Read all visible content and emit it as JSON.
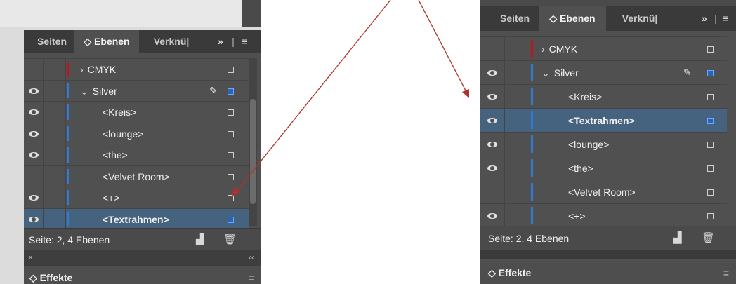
{
  "colors": {
    "red_layer": "#c0131b",
    "blue_layer": "#2f7ad6",
    "arrow": "#b0312b",
    "selection": "#45627f"
  },
  "left_panel": {
    "tabs": {
      "pages": "Seiten",
      "layers": "◇ Ebenen",
      "links": "Verknü|",
      "overflow": "»",
      "menu": "≡"
    },
    "rows": [
      {
        "label": "CMYK",
        "eye": false,
        "bar": "red",
        "indent": 0,
        "chevron": "›",
        "bold": false,
        "selected": false,
        "pen": false,
        "box": "white"
      },
      {
        "label": "Silver",
        "eye": true,
        "bar": "blue",
        "indent": 0,
        "chevron": "⌄",
        "bold": false,
        "selected": false,
        "pen": true,
        "box": "blue"
      },
      {
        "label": "<Kreis>",
        "eye": true,
        "bar": "blue",
        "indent": 1,
        "chevron": "",
        "bold": false,
        "selected": false,
        "pen": false,
        "box": "white"
      },
      {
        "label": "<lounge>",
        "eye": true,
        "bar": "blue",
        "indent": 1,
        "chevron": "",
        "bold": false,
        "selected": false,
        "pen": false,
        "box": "white"
      },
      {
        "label": "<the>",
        "eye": true,
        "bar": "blue",
        "indent": 1,
        "chevron": "",
        "bold": false,
        "selected": false,
        "pen": false,
        "box": "white"
      },
      {
        "label": "<Velvet Room>",
        "eye": false,
        "bar": "blue",
        "indent": 1,
        "chevron": "",
        "bold": false,
        "selected": false,
        "pen": false,
        "box": "white"
      },
      {
        "label": "<+>",
        "eye": true,
        "bar": "blue",
        "indent": 1,
        "chevron": "",
        "bold": false,
        "selected": false,
        "pen": false,
        "box": "white"
      },
      {
        "label": "<Textrahmen>",
        "eye": true,
        "bar": "blue",
        "indent": 1,
        "chevron": "",
        "bold": true,
        "selected": true,
        "pen": false,
        "box": "blue"
      }
    ],
    "footer": {
      "status": "Seite: 2, 4 Ebenen",
      "new_icon": "new-layer-icon",
      "trash_icon": "trash-icon"
    },
    "strip": {
      "close": "×",
      "collapse": "‹‹"
    },
    "effects_title": "◇ Effekte",
    "effects_menu": "≡"
  },
  "right_panel": {
    "tabs": {
      "pages": "Seiten",
      "layers": "◇ Ebenen",
      "links": "Verknü|",
      "overflow": "»",
      "menu": "≡"
    },
    "rows": [
      {
        "label": "CMYK",
        "eye": false,
        "bar": "red",
        "indent": 0,
        "chevron": "›",
        "bold": false,
        "selected": false,
        "pen": false,
        "box": "white"
      },
      {
        "label": "Silver",
        "eye": true,
        "bar": "blue",
        "indent": 0,
        "chevron": "⌄",
        "bold": false,
        "selected": false,
        "pen": true,
        "box": "blue"
      },
      {
        "label": "<Kreis>",
        "eye": true,
        "bar": "blue",
        "indent": 1,
        "chevron": "",
        "bold": false,
        "selected": false,
        "pen": false,
        "box": "white"
      },
      {
        "label": "<Textrahmen>",
        "eye": true,
        "bar": "blue",
        "indent": 1,
        "chevron": "",
        "bold": true,
        "selected": true,
        "pen": false,
        "box": "blue"
      },
      {
        "label": "<lounge>",
        "eye": true,
        "bar": "blue",
        "indent": 1,
        "chevron": "",
        "bold": false,
        "selected": false,
        "pen": false,
        "box": "white"
      },
      {
        "label": "<the>",
        "eye": true,
        "bar": "blue",
        "indent": 1,
        "chevron": "",
        "bold": false,
        "selected": false,
        "pen": false,
        "box": "white"
      },
      {
        "label": "<Velvet Room>",
        "eye": false,
        "bar": "blue",
        "indent": 1,
        "chevron": "",
        "bold": false,
        "selected": false,
        "pen": false,
        "box": "white"
      },
      {
        "label": "<+>",
        "eye": true,
        "bar": "blue",
        "indent": 1,
        "chevron": "",
        "bold": false,
        "selected": false,
        "pen": false,
        "box": "white"
      }
    ],
    "footer": {
      "status": "Seite: 2, 4 Ebenen",
      "new_icon": "new-layer-icon",
      "trash_icon": "trash-icon"
    },
    "effects_title": "◇ Effekte",
    "effects_menu": "≡"
  }
}
